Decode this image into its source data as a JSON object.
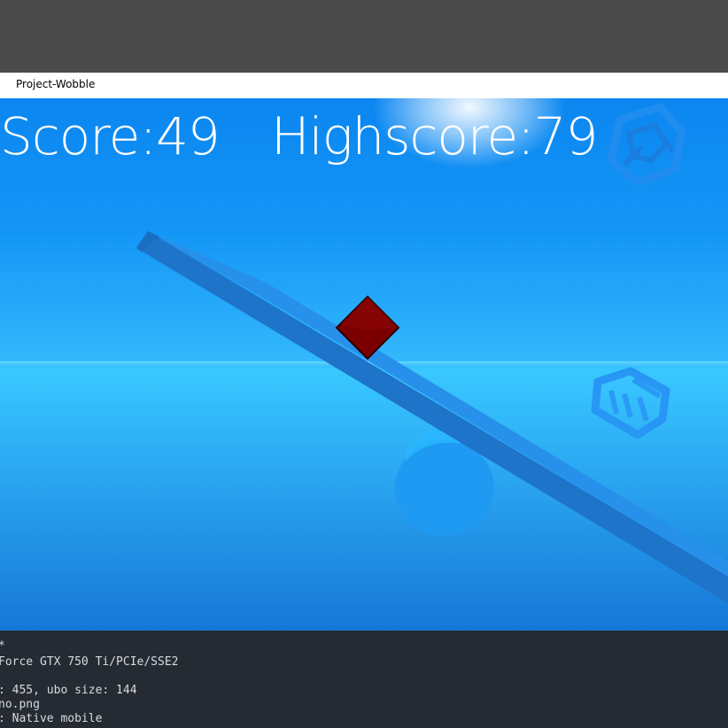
{
  "window": {
    "title": "Project-Wobble"
  },
  "hud": {
    "score_text": "Score:49",
    "highscore_text": "Highscore:79"
  },
  "game": {
    "objects": [
      "seesaw-plank",
      "fulcrum-cylinder",
      "player-cube",
      "floating-dice-top",
      "floating-dice-right"
    ],
    "player_color": "#7a0000",
    "plank_color": "#1f7fd8",
    "sky_colors": [
      "#0b86f0",
      "#39c8ff",
      "#1677d6"
    ]
  },
  "console": {
    "lines": [
      "*",
      "Force GTX 750 Ti/PCIe/SSE2",
      "",
      ": 455, ubo size: 144",
      "no.png",
      ": Native mobile"
    ]
  }
}
